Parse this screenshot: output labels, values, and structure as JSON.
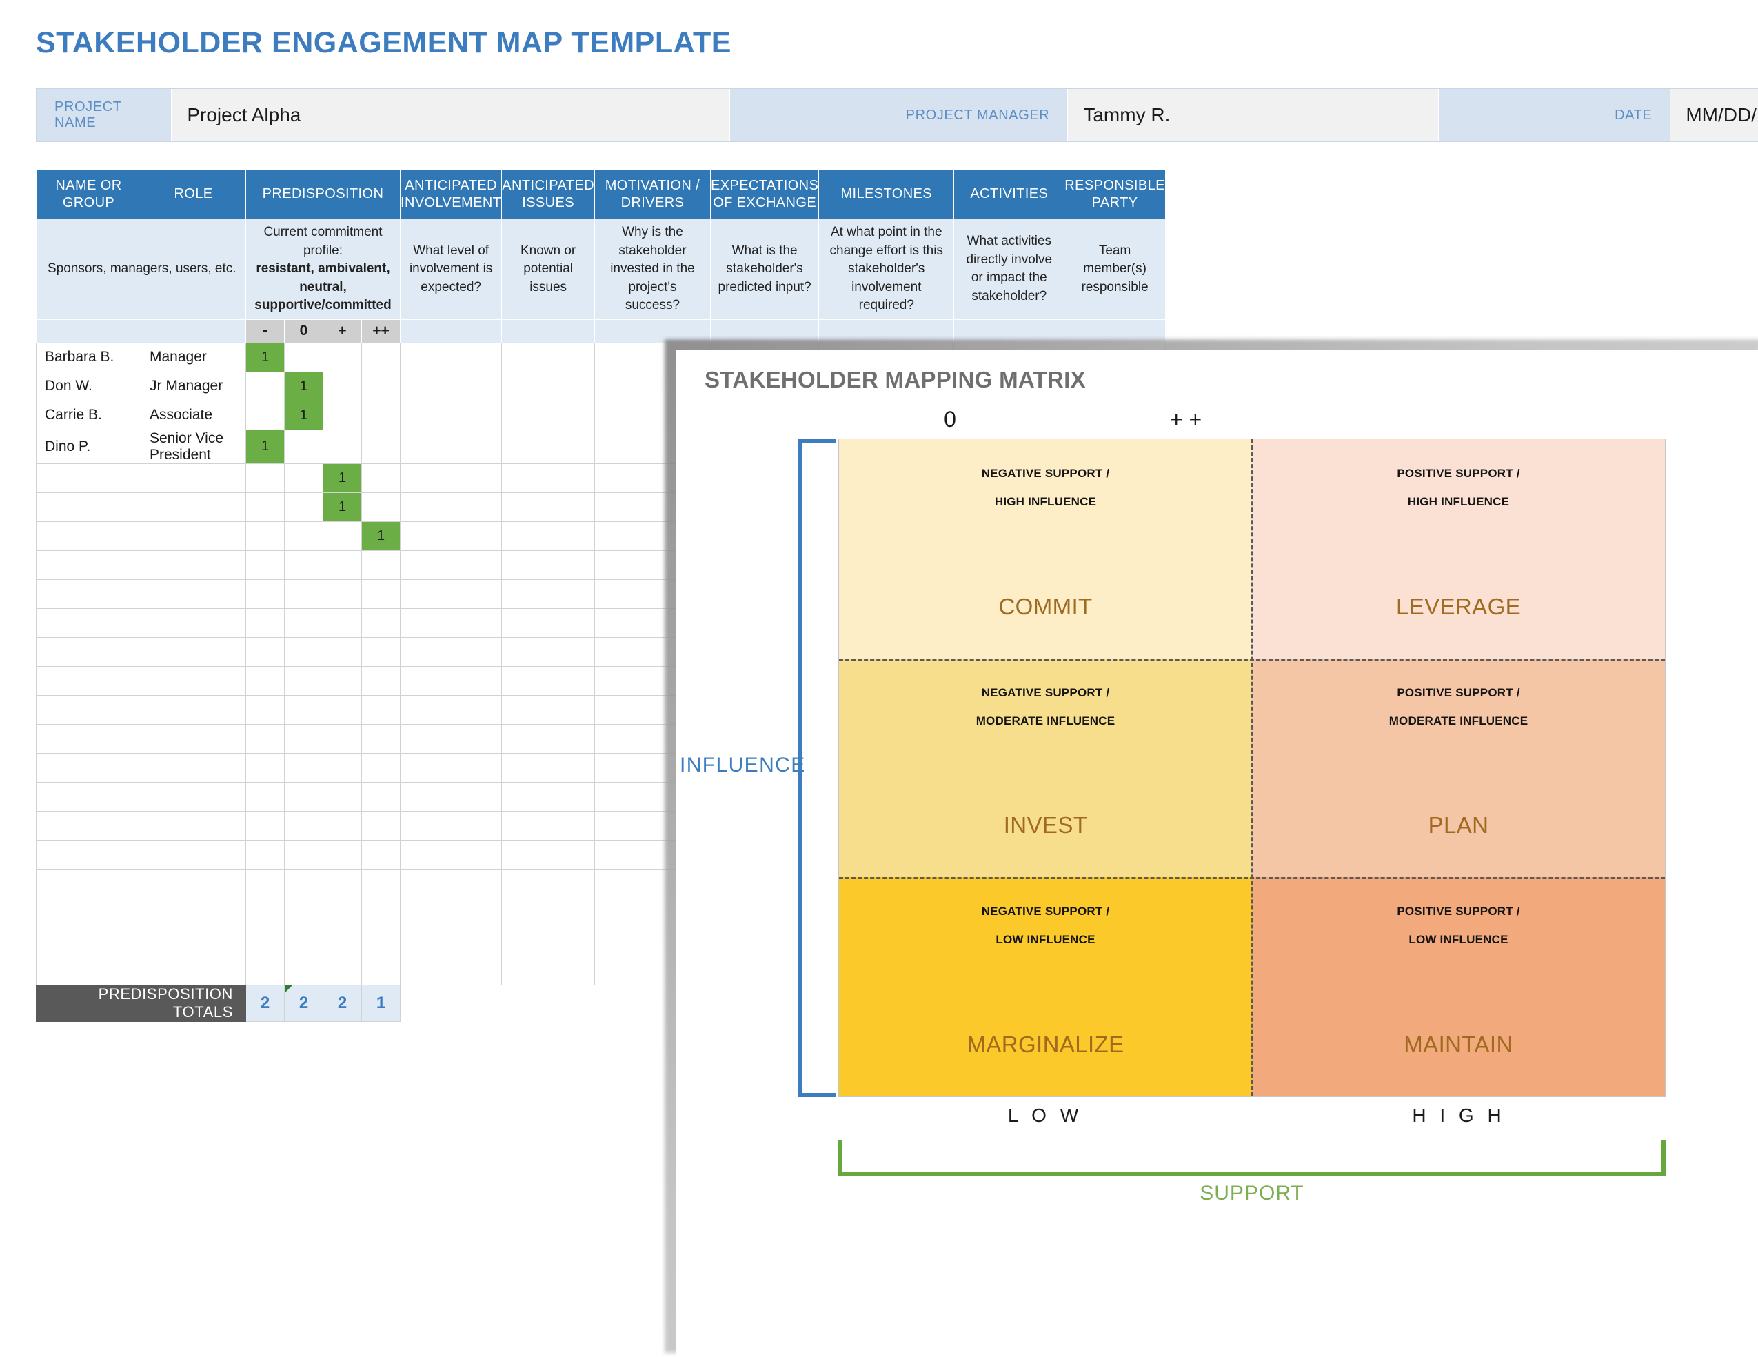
{
  "page_title": "STAKEHOLDER ENGAGEMENT MAP TEMPLATE",
  "info_bar": {
    "project_name_label": "PROJECT NAME",
    "project_name_value": "Project Alpha",
    "project_manager_label": "PROJECT MANAGER",
    "project_manager_value": "Tammy R.",
    "date_label": "DATE",
    "date_value": "MM/DD/"
  },
  "table": {
    "headers": {
      "name_or_group": "NAME OR GROUP",
      "role": "ROLE",
      "predisposition": "PREDISPOSITION",
      "anticipated_involvement": "ANTICIPATED INVOLVEMENT",
      "anticipated_issues": "ANTICIPATED ISSUES",
      "motivation_drivers": "MOTIVATION / DRIVERS",
      "expectations_of_exchange": "EXPECTATIONS OF EXCHANGE",
      "milestones": "MILESTONES",
      "activities": "ACTIVITIES",
      "responsible_party": "RESPONSIBLE PARTY"
    },
    "hints": {
      "name_or_group": "Sponsors, managers, users, etc.",
      "predisposition_line1": "Current commitment profile:",
      "predisposition_line2": "resistant, ambivalent, neutral,",
      "predisposition_line3": "supportive/committed",
      "anticipated_involvement": "What level of involvement is expected?",
      "anticipated_issues": "Known or potential issues",
      "motivation_drivers": "Why is the stakeholder invested in the project's success?",
      "expectations_of_exchange": "What is the stakeholder's predicted input?",
      "milestones": "At what point in the change effort is this stakeholder's involvement required?",
      "activities": "What activities directly involve or impact the stakeholder?",
      "responsible_party": "Team member(s) responsible"
    },
    "predisposition_levels": [
      "-",
      "0",
      "+",
      "++"
    ],
    "rows": [
      {
        "name": "Barbara B.",
        "role": "Manager",
        "predisposition": 0,
        "mark": "1"
      },
      {
        "name": "Don W.",
        "role": "Jr Manager",
        "predisposition": 1,
        "mark": "1"
      },
      {
        "name": "Carrie B.",
        "role": "Associate",
        "predisposition": 1,
        "mark": "1"
      },
      {
        "name": "Dino P.",
        "role": "Senior Vice President",
        "predisposition": 0,
        "mark": "1"
      },
      {
        "name": "",
        "role": "",
        "predisposition": 2,
        "mark": "1"
      },
      {
        "name": "",
        "role": "",
        "predisposition": 2,
        "mark": "1"
      },
      {
        "name": "",
        "role": "",
        "predisposition": 3,
        "mark": "1"
      },
      {
        "name": "",
        "role": "",
        "predisposition": -1,
        "mark": ""
      },
      {
        "name": "",
        "role": "",
        "predisposition": -1,
        "mark": ""
      },
      {
        "name": "",
        "role": "",
        "predisposition": -1,
        "mark": ""
      },
      {
        "name": "",
        "role": "",
        "predisposition": -1,
        "mark": ""
      },
      {
        "name": "",
        "role": "",
        "predisposition": -1,
        "mark": ""
      },
      {
        "name": "",
        "role": "",
        "predisposition": -1,
        "mark": ""
      },
      {
        "name": "",
        "role": "",
        "predisposition": -1,
        "mark": ""
      },
      {
        "name": "",
        "role": "",
        "predisposition": -1,
        "mark": ""
      },
      {
        "name": "",
        "role": "",
        "predisposition": -1,
        "mark": ""
      },
      {
        "name": "",
        "role": "",
        "predisposition": -1,
        "mark": ""
      },
      {
        "name": "",
        "role": "",
        "predisposition": -1,
        "mark": ""
      },
      {
        "name": "",
        "role": "",
        "predisposition": -1,
        "mark": ""
      },
      {
        "name": "",
        "role": "",
        "predisposition": -1,
        "mark": ""
      },
      {
        "name": "",
        "role": "",
        "predisposition": -1,
        "mark": ""
      },
      {
        "name": "",
        "role": "",
        "predisposition": -1,
        "mark": ""
      }
    ],
    "totals_label": "PREDISPOSITION TOTALS",
    "totals": [
      "2",
      "2",
      "2",
      "1"
    ]
  },
  "matrix": {
    "title": "STAKEHOLDER MAPPING MATRIX",
    "col_head_left": "0",
    "col_head_right": "+ +",
    "influence_label": "INFLUENCE",
    "support_label": "SUPPORT",
    "axis_low": "L O W",
    "axis_high": "H I G H",
    "quadrants": [
      {
        "sub1": "NEGATIVE SUPPORT /",
        "sub2": "HIGH INFLUENCE",
        "name": "COMMIT",
        "color": "#fdeec8"
      },
      {
        "sub1": "POSITIVE SUPPORT /",
        "sub2": "HIGH INFLUENCE",
        "name": "LEVERAGE",
        "color": "#fbe1d3"
      },
      {
        "sub1": "NEGATIVE SUPPORT /",
        "sub2": "MODERATE INFLUENCE",
        "name": "INVEST",
        "color": "#f7de8c"
      },
      {
        "sub1": "POSITIVE SUPPORT /",
        "sub2": "MODERATE INFLUENCE",
        "name": "PLAN",
        "color": "#f5c6a5"
      },
      {
        "sub1": "NEGATIVE SUPPORT /",
        "sub2": "LOW INFLUENCE",
        "name": "MARGINALIZE",
        "color": "#fcc92b"
      },
      {
        "sub1": "POSITIVE SUPPORT /",
        "sub2": "LOW INFLUENCE",
        "name": "MAINTAIN",
        "color": "#f2a97c"
      }
    ]
  },
  "colors": {
    "title_blue": "#3c7cbf",
    "header_blue": "#2f77b5",
    "hint_blue": "#e0eaf5",
    "mark_green": "#6cae46",
    "totals_gray": "#595959",
    "support_green": "#67a83e"
  }
}
